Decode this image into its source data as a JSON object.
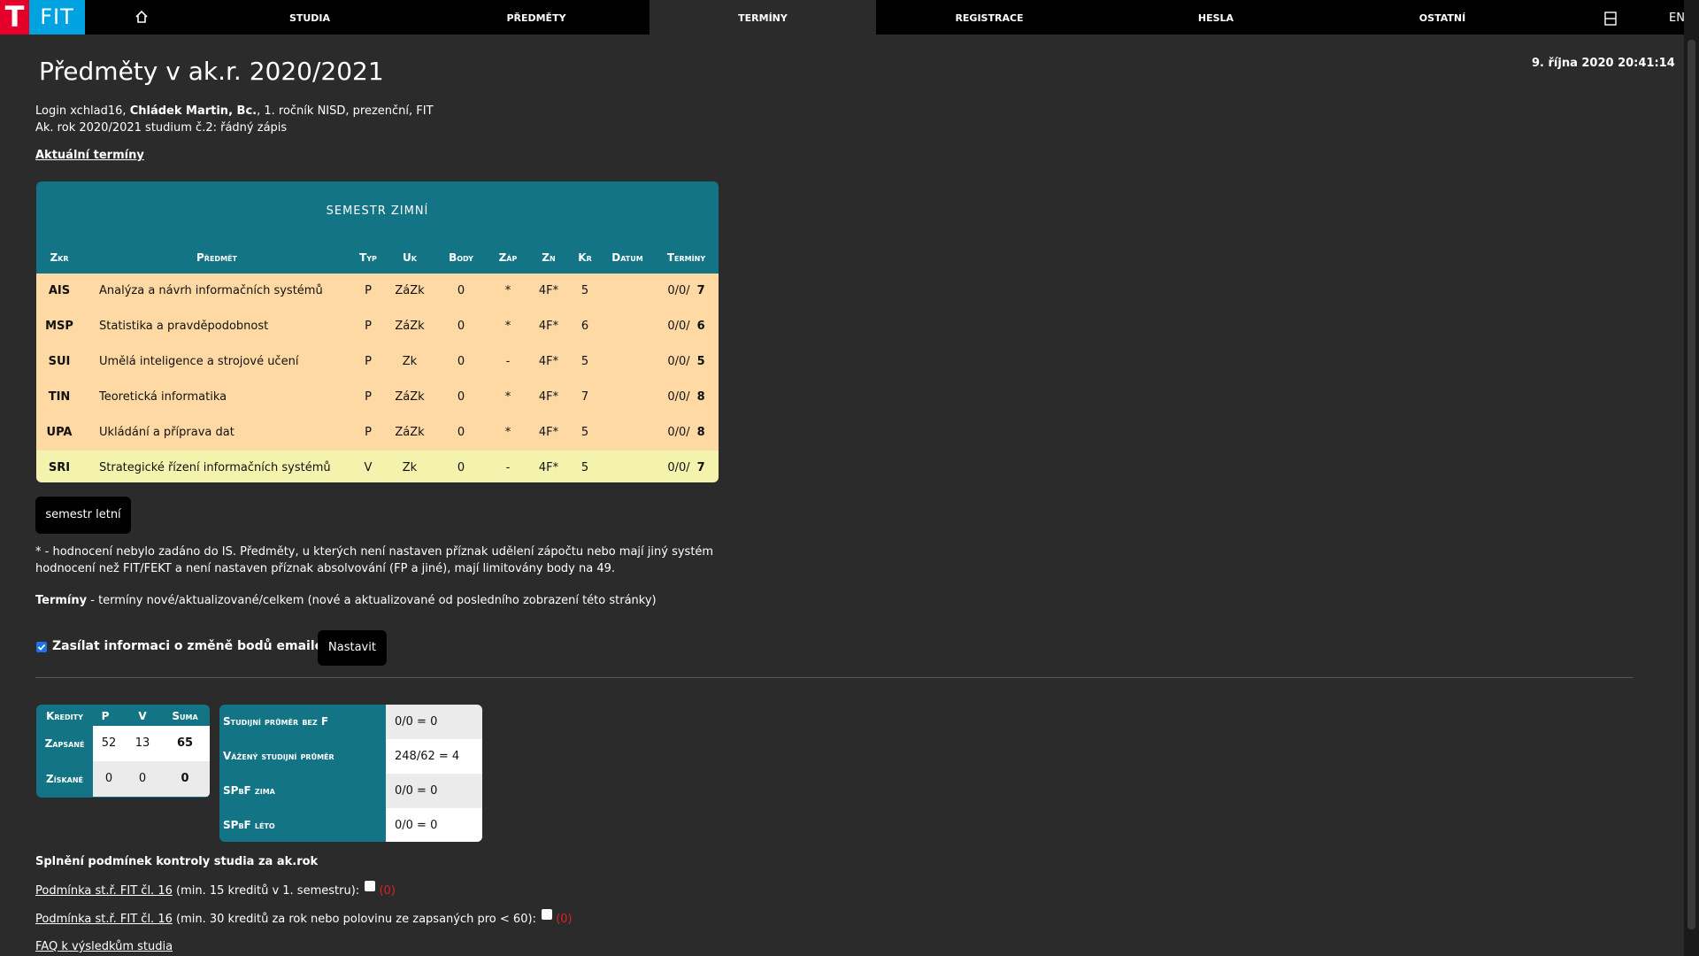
{
  "nav": {
    "logo_t": "T",
    "logo_fit": "FIT",
    "items": [
      {
        "label": "Studia"
      },
      {
        "label": "Předměty"
      },
      {
        "label": "Termíny"
      },
      {
        "label": "Registrace"
      },
      {
        "label": "Hesla"
      },
      {
        "label": "Ostatní"
      }
    ],
    "active": "Termíny",
    "lang": "EN"
  },
  "header": {
    "title": "Předměty v ak.r. 2020/2021",
    "datetime": "9. října 2020 20:41:14"
  },
  "user": {
    "login_prefix": "Login xchlad16, ",
    "name": "Chládek Martin, Bc.",
    "login_suffix": ", 1. ročník NISD, prezenční, FIT",
    "study_line": "Ak. rok 2020/2021 studium č.2: řádný zápis"
  },
  "links": {
    "current_terms": "Aktuální termíny",
    "faq": "FAQ k výsledkům studia"
  },
  "semester": {
    "title": "Semestr zimní",
    "headers": [
      "Zkr",
      "Předmět",
      "Typ",
      "Uk",
      "Body",
      "Záp",
      "Zn",
      "Kr",
      "Datum",
      "Termíny"
    ],
    "rows": [
      {
        "zkr": "AIS",
        "name": "Analýza a návrh informačních systémů",
        "typ": "P",
        "uk": "ZáZk",
        "body": "0",
        "zap": "*",
        "zn": "4F*",
        "kr": "5",
        "datum": "",
        "terms": "0/0/",
        "terms_total": "7"
      },
      {
        "zkr": "MSP",
        "name": "Statistika a pravděpodobnost",
        "typ": "P",
        "uk": "ZáZk",
        "body": "0",
        "zap": "*",
        "zn": "4F*",
        "kr": "6",
        "datum": "",
        "terms": "0/0/",
        "terms_total": "6"
      },
      {
        "zkr": "SUI",
        "name": "Umělá inteligence a strojové učení",
        "typ": "P",
        "uk": "Zk",
        "body": "0",
        "zap": "-",
        "zn": "4F*",
        "kr": "5",
        "datum": "",
        "terms": "0/0/",
        "terms_total": "5"
      },
      {
        "zkr": "TIN",
        "name": "Teoretická informatika",
        "typ": "P",
        "uk": "ZáZk",
        "body": "0",
        "zap": "*",
        "zn": "4F*",
        "kr": "7",
        "datum": "",
        "terms": "0/0/",
        "terms_total": "8"
      },
      {
        "zkr": "UPA",
        "name": "Ukládání a příprava dat",
        "typ": "P",
        "uk": "ZáZk",
        "body": "0",
        "zap": "*",
        "zn": "4F*",
        "kr": "5",
        "datum": "",
        "terms": "0/0/",
        "terms_total": "8"
      },
      {
        "zkr": "SRI",
        "name": "Strategické řízení informačních systémů",
        "typ": "V",
        "uk": "Zk",
        "body": "0",
        "zap": "-",
        "zn": "4F*",
        "kr": "5",
        "datum": "",
        "terms": "0/0/",
        "terms_total": "7"
      }
    ]
  },
  "buttons": {
    "summer": "semestr letní",
    "set": "Nastavit"
  },
  "notes": {
    "note1": "* - hodnocení nebylo zadáno do IS. Předměty, u kterých není nastaven příznak udělení zápočtu nebo mají jiný systém hodnocení než FIT/FEKT a není nastaven příznak absolvování (FP a jiné), mají limitovány body na 49.",
    "note2_bold": "Termíny",
    "note2_rest": " - termíny nové/aktualizované/celkem (nové a aktualizované od posledního zobrazení této stránky)"
  },
  "email": {
    "label": "Zasílat informaci o změně bodů emailem",
    "checked": true
  },
  "credits": {
    "headers": [
      "Kredity",
      "P",
      "V",
      "Suma"
    ],
    "rows": [
      {
        "label": "Zapsané",
        "p": "52",
        "v": "13",
        "sum": "65"
      },
      {
        "label": "Získané",
        "p": "0",
        "v": "0",
        "sum": "0"
      }
    ]
  },
  "averages": [
    {
      "label": "Studijní průměr bez F",
      "value": "0/0 = 0"
    },
    {
      "label": "Vážený studijní průměr",
      "value": "248/62 = 4"
    },
    {
      "label": "SPbF zima",
      "value": "0/0 = 0"
    },
    {
      "label": "SPbF léto",
      "value": "0/0 = 0"
    }
  ],
  "conditions": {
    "title": "Splnění podmínek kontroly studia za ak.rok",
    "items": [
      {
        "link": "Podmínka st.ř. FIT čl. 16",
        "text": " (min. 15 kreditů v 1. semestru):",
        "result": "(0)",
        "checked": false
      },
      {
        "link": "Podmínka st.ř. FIT čl. 16",
        "text": " (min. 30 kreditů za rok nebo polovinu ze zapsaných pro < 60):",
        "result": "(0)",
        "checked": false
      }
    ]
  },
  "colors": {
    "table_header": "#127485",
    "row_required": "#ffd9a3",
    "row_optional": "#f4f3ae",
    "logo_red": "#e4002b",
    "logo_blue": "#00a2e0",
    "result_red": "#e02020"
  }
}
